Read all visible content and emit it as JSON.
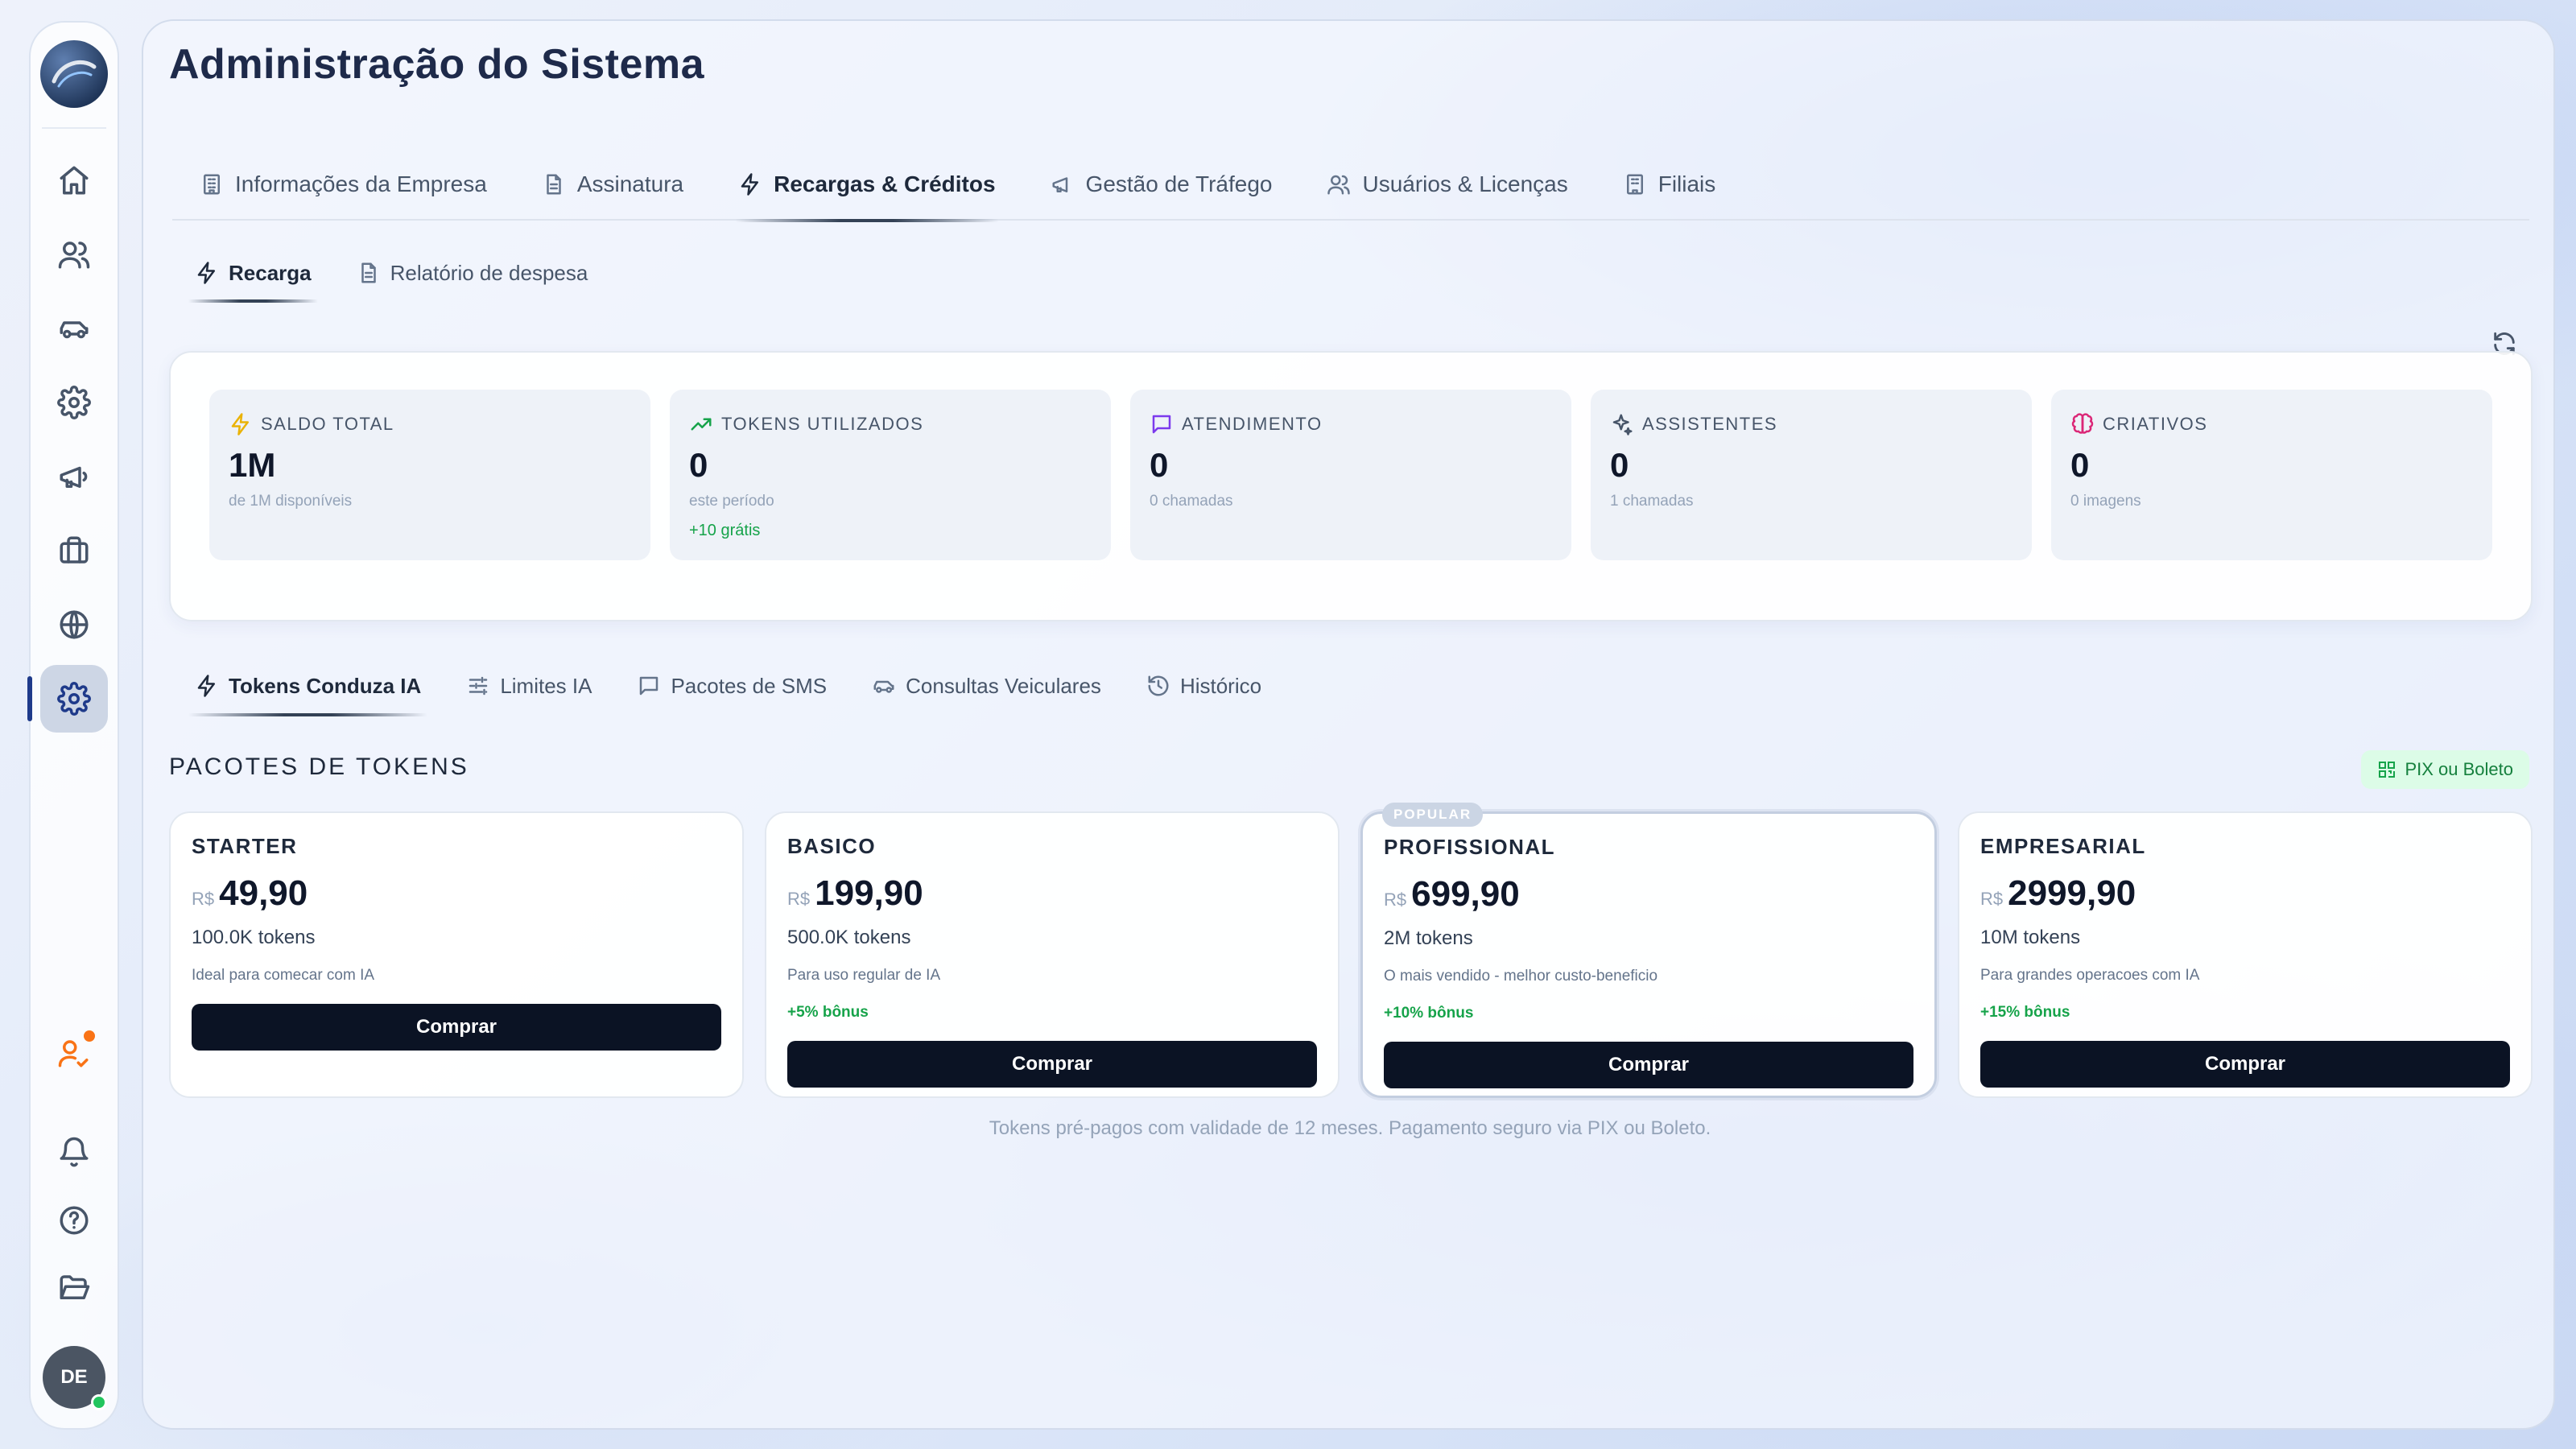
{
  "page": {
    "title": "Administração do Sistema"
  },
  "sidebar": {
    "items": [
      {
        "icon": "home-icon"
      },
      {
        "icon": "users-icon"
      },
      {
        "icon": "car-icon"
      },
      {
        "icon": "gear-icon"
      },
      {
        "icon": "megaphone-icon"
      },
      {
        "icon": "briefcase-icon"
      },
      {
        "icon": "globe-icon"
      },
      {
        "icon": "gear-icon",
        "active": true
      }
    ],
    "avatar_initials": "DE"
  },
  "tabs": [
    {
      "label": "Informações da Empresa",
      "icon": "building-icon"
    },
    {
      "label": "Assinatura",
      "icon": "document-icon"
    },
    {
      "label": "Recargas & Créditos",
      "icon": "lightning-icon",
      "active": true
    },
    {
      "label": "Gestão de Tráfego",
      "icon": "megaphone-icon"
    },
    {
      "label": "Usuários & Licenças",
      "icon": "users-icon"
    },
    {
      "label": "Filiais",
      "icon": "building-icon"
    }
  ],
  "subtabs": [
    {
      "label": "Recarga",
      "icon": "lightning-icon",
      "active": true
    },
    {
      "label": "Relatório de despesa",
      "icon": "document-icon"
    }
  ],
  "stats": [
    {
      "label": "SALDO TOTAL",
      "value": "1M",
      "sub": "de 1M disponíveis",
      "extra": "",
      "icon": "lightning-icon",
      "color": "#eab308"
    },
    {
      "label": "TOKENS UTILIZADOS",
      "value": "0",
      "sub": "este período",
      "extra": "+10 grátis",
      "icon": "trending-up-icon",
      "color": "#16a34a"
    },
    {
      "label": "ATENDIMENTO",
      "value": "0",
      "sub": "0 chamadas",
      "extra": "",
      "icon": "chat-icon",
      "color": "#7c3aed"
    },
    {
      "label": "ASSISTENTES",
      "value": "0",
      "sub": "1 chamadas",
      "extra": "",
      "icon": "sparkles-icon",
      "color": "#475569"
    },
    {
      "label": "CRIATIVOS",
      "value": "0",
      "sub": "0 imagens",
      "extra": "",
      "icon": "brain-icon",
      "color": "#db2777"
    }
  ],
  "product_tabs": [
    {
      "label": "Tokens Conduza IA",
      "icon": "lightning-icon",
      "active": true
    },
    {
      "label": "Limites IA",
      "icon": "sliders-icon"
    },
    {
      "label": "Pacotes de SMS",
      "icon": "chat-icon"
    },
    {
      "label": "Consultas Veiculares",
      "icon": "car-icon"
    },
    {
      "label": "Histórico",
      "icon": "history-icon"
    }
  ],
  "packages_section": {
    "title": "PACOTES DE TOKENS",
    "payment_badge": "PIX ou Boleto",
    "packages": [
      {
        "name": "STARTER",
        "currency": "R$",
        "price": "49,90",
        "tokens": "100.0K tokens",
        "desc": "Ideal para comecar com IA",
        "bonus": "",
        "button": "Comprar",
        "popular": false
      },
      {
        "name": "BASICO",
        "currency": "R$",
        "price": "199,90",
        "tokens": "500.0K tokens",
        "desc": "Para uso regular de IA",
        "bonus": "+5% bônus",
        "button": "Comprar",
        "popular": false
      },
      {
        "name": "PROFISSIONAL",
        "currency": "R$",
        "price": "699,90",
        "tokens": "2M tokens",
        "desc": "O mais vendido - melhor custo-beneficio",
        "bonus": "+10% bônus",
        "button": "Comprar",
        "popular": true,
        "popular_label": "POPULAR"
      },
      {
        "name": "EMPRESARIAL",
        "currency": "R$",
        "price": "2999,90",
        "tokens": "10M tokens",
        "desc": "Para grandes operacoes com IA",
        "bonus": "+15% bônus",
        "button": "Comprar",
        "popular": false
      }
    ],
    "footnote": "Tokens pré-pagos com validade de 12 meses. Pagamento seguro via PIX ou Boleto."
  }
}
